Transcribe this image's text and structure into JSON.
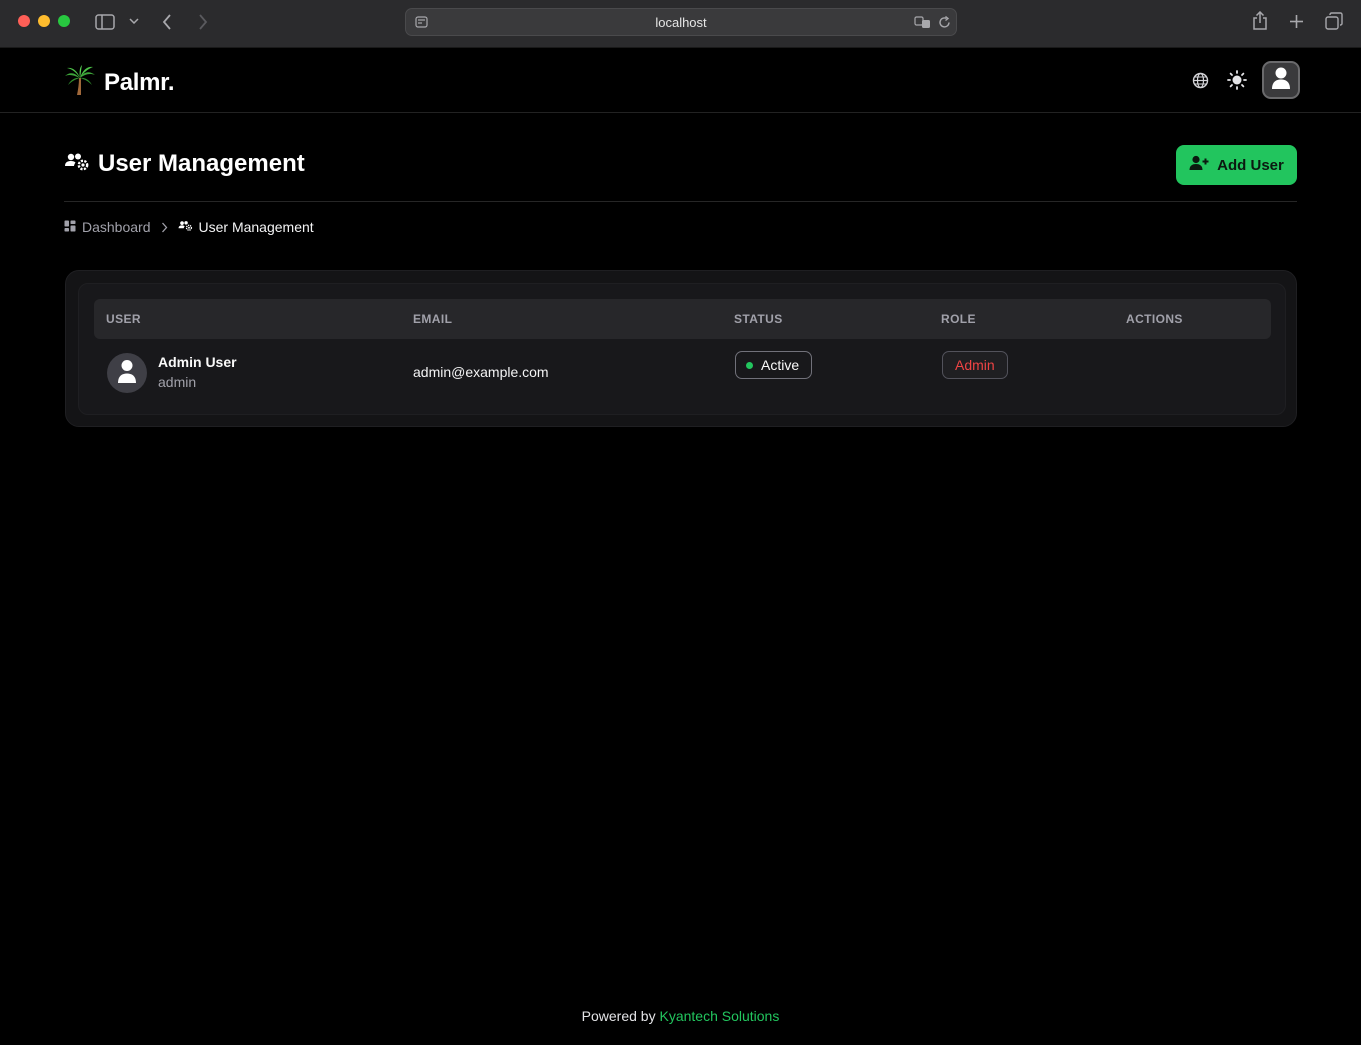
{
  "browser": {
    "url": "localhost"
  },
  "app": {
    "name": "Palmr.",
    "logo_icon": "palm-tree-icon",
    "header_icons": [
      "globe-icon",
      "sun-icon",
      "user-icon"
    ]
  },
  "page": {
    "title": "User Management",
    "add_button_label": "Add User"
  },
  "breadcrumb": {
    "items": [
      {
        "label": "Dashboard",
        "icon": "dashboard-icon"
      },
      {
        "label": "User Management",
        "icon": "users-cog-icon"
      }
    ]
  },
  "table": {
    "columns": [
      "USER",
      "EMAIL",
      "STATUS",
      "ROLE",
      "ACTIONS"
    ],
    "rows": [
      {
        "name": "Admin User",
        "username": "admin",
        "email": "admin@example.com",
        "status": "Active",
        "role": "Admin"
      }
    ]
  },
  "footer": {
    "prefix": "Powered by",
    "link": "Kyantech Solutions"
  },
  "colors": {
    "accent": "#22c55e",
    "admin_role": "#ef4444",
    "background": "#000000"
  }
}
